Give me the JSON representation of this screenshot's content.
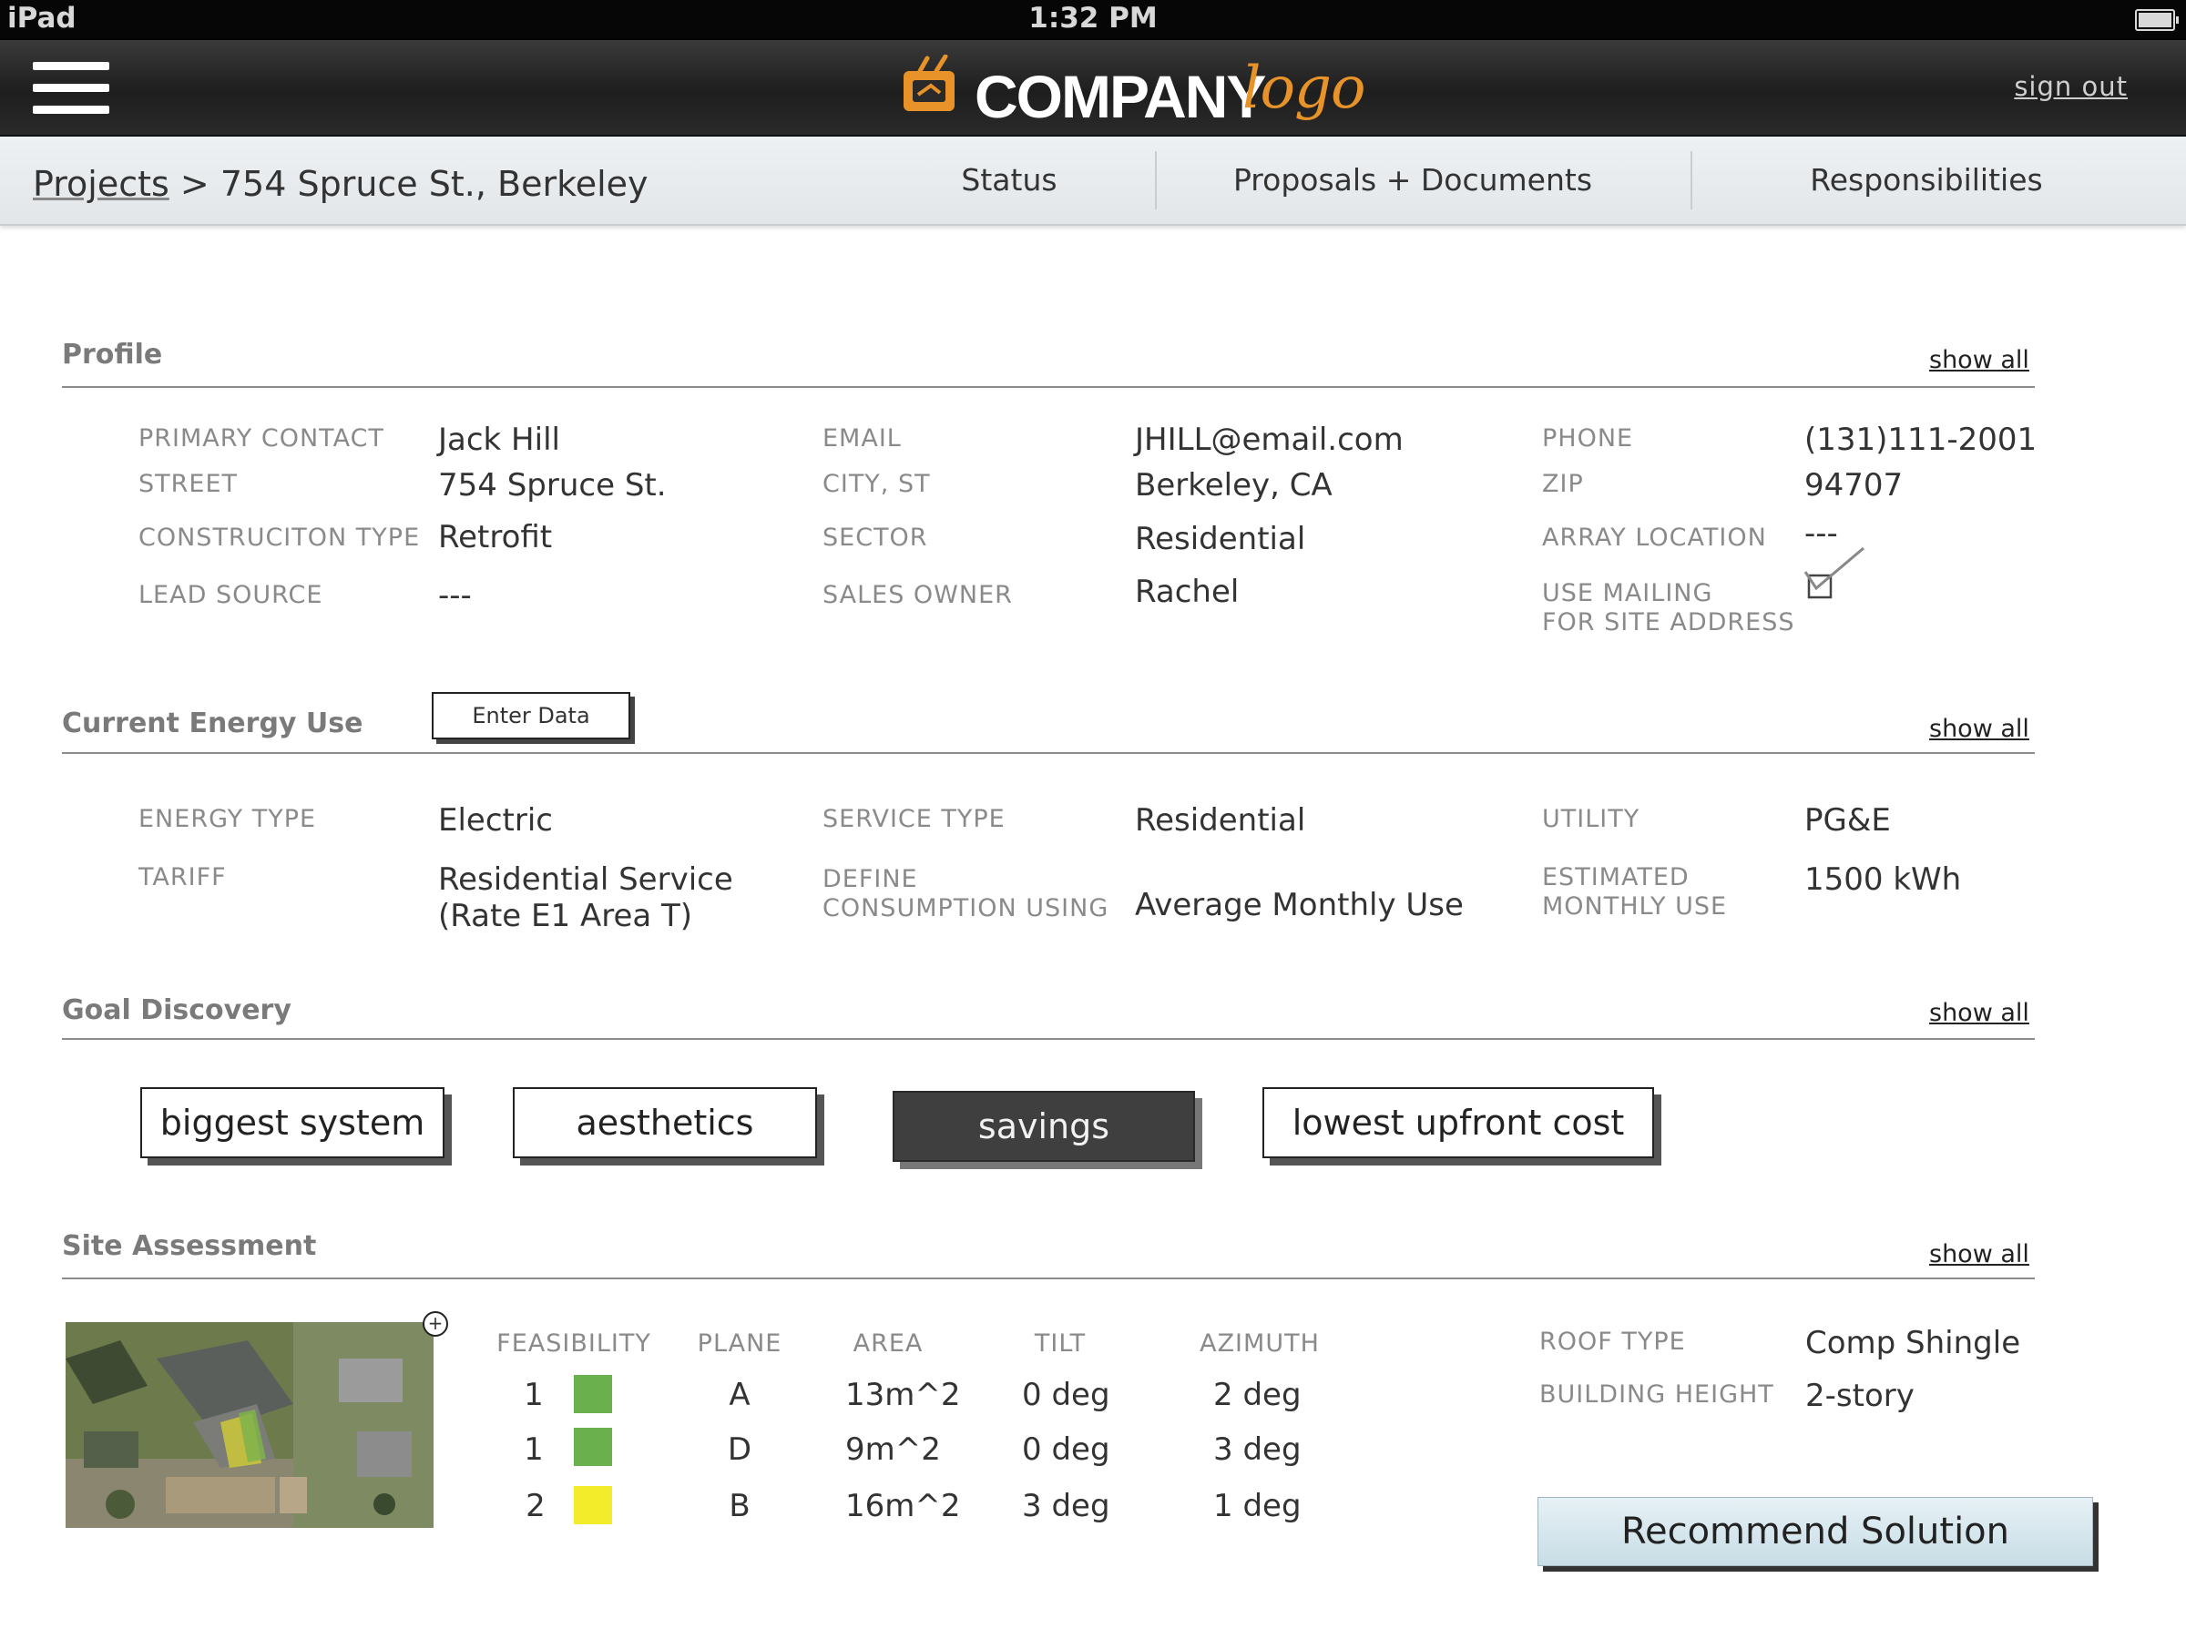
{
  "status_bar": {
    "device": "iPad",
    "time": "1:32 PM"
  },
  "header": {
    "logo_word": "COMPANY",
    "logo_script": "logo",
    "sign_out": "sign out"
  },
  "nav": {
    "breadcrumb_root": "Projects",
    "breadcrumb_sep": ">",
    "breadcrumb_current": "754 Spruce St., Berkeley",
    "tabs": [
      {
        "label": "Status"
      },
      {
        "label": "Proposals + Documents"
      },
      {
        "label": "Responsibilities"
      }
    ]
  },
  "profile": {
    "title": "Profile",
    "show_all": "show all",
    "fields": {
      "primary_contact": {
        "label": "PRIMARY CONTACT",
        "value": "Jack Hill"
      },
      "email": {
        "label": "EMAIL",
        "value": "JHILL@email.com"
      },
      "phone": {
        "label": "PHONE",
        "value": "(131)111-2001"
      },
      "street": {
        "label": "STREET",
        "value": "754 Spruce St."
      },
      "city_st": {
        "label": "CITY, ST",
        "value": "Berkeley, CA"
      },
      "zip": {
        "label": "ZIP",
        "value": "94707"
      },
      "construction_type": {
        "label": "CONSTRUCITON TYPE",
        "value": "Retrofit"
      },
      "sector": {
        "label": "SECTOR",
        "value": "Residential"
      },
      "array_location": {
        "label": "ARRAY LOCATION",
        "value": "---"
      },
      "lead_source": {
        "label": "LEAD SOURCE",
        "value": "---"
      },
      "sales_owner": {
        "label": "SALES OWNER",
        "value": "Rachel"
      },
      "use_mailing": {
        "label_line1": "USE MAILING",
        "label_line2": "FOR SITE ADDRESS",
        "checked": true
      }
    }
  },
  "energy": {
    "title": "Current Energy Use",
    "enter_data": "Enter Data",
    "show_all": "show all",
    "fields": {
      "energy_type": {
        "label": "ENERGY TYPE",
        "value": "Electric"
      },
      "service_type": {
        "label": "SERVICE TYPE",
        "value": "Residential"
      },
      "utility": {
        "label": "UTILITY",
        "value": "PG&E"
      },
      "tariff": {
        "label": "TARIFF",
        "value_line1": "Residential Service",
        "value_line2": "(Rate E1 Area T)"
      },
      "define_consumption": {
        "label_line1": "DEFINE",
        "label_line2": "CONSUMPTION USING",
        "value": "Average Monthly Use"
      },
      "est_monthly_use": {
        "label_line1": "ESTIMATED",
        "label_line2": "MONTHLY USE",
        "value": "1500 kWh"
      }
    }
  },
  "goals": {
    "title": "Goal Discovery",
    "show_all": "show all",
    "options": [
      {
        "label": "biggest system",
        "selected": false
      },
      {
        "label": "aesthetics",
        "selected": false
      },
      {
        "label": "savings",
        "selected": true
      },
      {
        "label": "lowest upfront cost",
        "selected": false
      }
    ]
  },
  "site": {
    "title": "Site Assessment",
    "show_all": "show all",
    "columns": [
      "FEASIBILITY",
      "PLANE",
      "AREA",
      "TILT",
      "AZIMUTH"
    ],
    "rows": [
      {
        "feasibility": "1",
        "color": "#6ab04c",
        "plane": "A",
        "area": "13m^2",
        "tilt": "0 deg",
        "azimuth": "2 deg"
      },
      {
        "feasibility": "1",
        "color": "#6ab04c",
        "plane": "D",
        "area": "9m^2",
        "tilt": "0 deg",
        "azimuth": "3 deg"
      },
      {
        "feasibility": "2",
        "color": "#f3ec2a",
        "plane": "B",
        "area": "16m^2",
        "tilt": "3 deg",
        "azimuth": "1 deg"
      }
    ],
    "roof_type": {
      "label": "ROOF TYPE",
      "value": "Comp Shingle"
    },
    "building_height": {
      "label": "BUILDING HEIGHT",
      "value": "2-story"
    },
    "recommend": "Recommend Solution"
  },
  "colors": {
    "header_bg": "#2a2a2a",
    "logo_orange": "#e8922a",
    "feasible_green": "#6ab04c",
    "feasible_yellow": "#f3ec2a"
  }
}
